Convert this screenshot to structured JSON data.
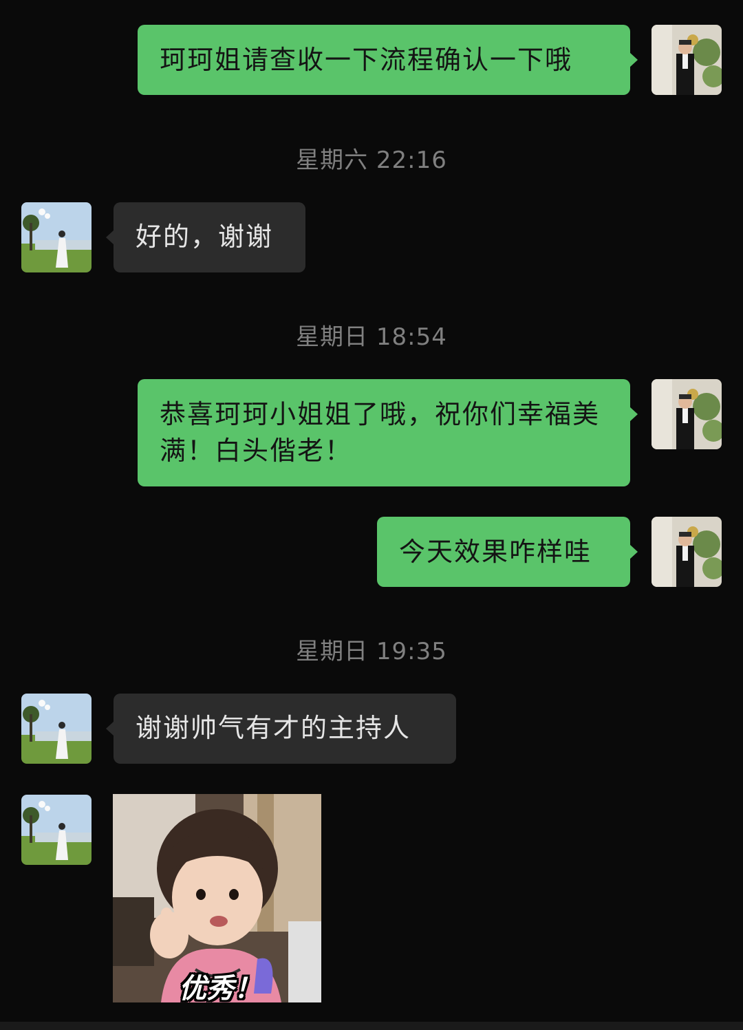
{
  "messages": [
    {
      "side": "out",
      "text": "珂珂姐请查收一下流程确认一下哦"
    },
    {
      "time": "星期六 22:16"
    },
    {
      "side": "in",
      "text": "好的，谢谢"
    },
    {
      "time": "星期日 18:54"
    },
    {
      "side": "out",
      "text": "恭喜珂珂小姐姐了哦，祝你们幸福美满！白头偕老！"
    },
    {
      "side": "out",
      "text": "今天效果咋样哇"
    },
    {
      "time": "星期日 19:35"
    },
    {
      "side": "in",
      "text": "谢谢帅气有才的主持人"
    },
    {
      "side": "in",
      "sticker_caption": "优秀！"
    }
  ],
  "colors": {
    "background": "#0a0a0a",
    "outgoing_bubble": "#5ac46a",
    "incoming_bubble": "#2c2c2c",
    "timestamp": "#808080"
  },
  "icons": {
    "self_avatar": "host-avatar-icon",
    "contact_avatar": "contact-avatar-icon",
    "sticker": "thumbs-up-girl-sticker"
  }
}
